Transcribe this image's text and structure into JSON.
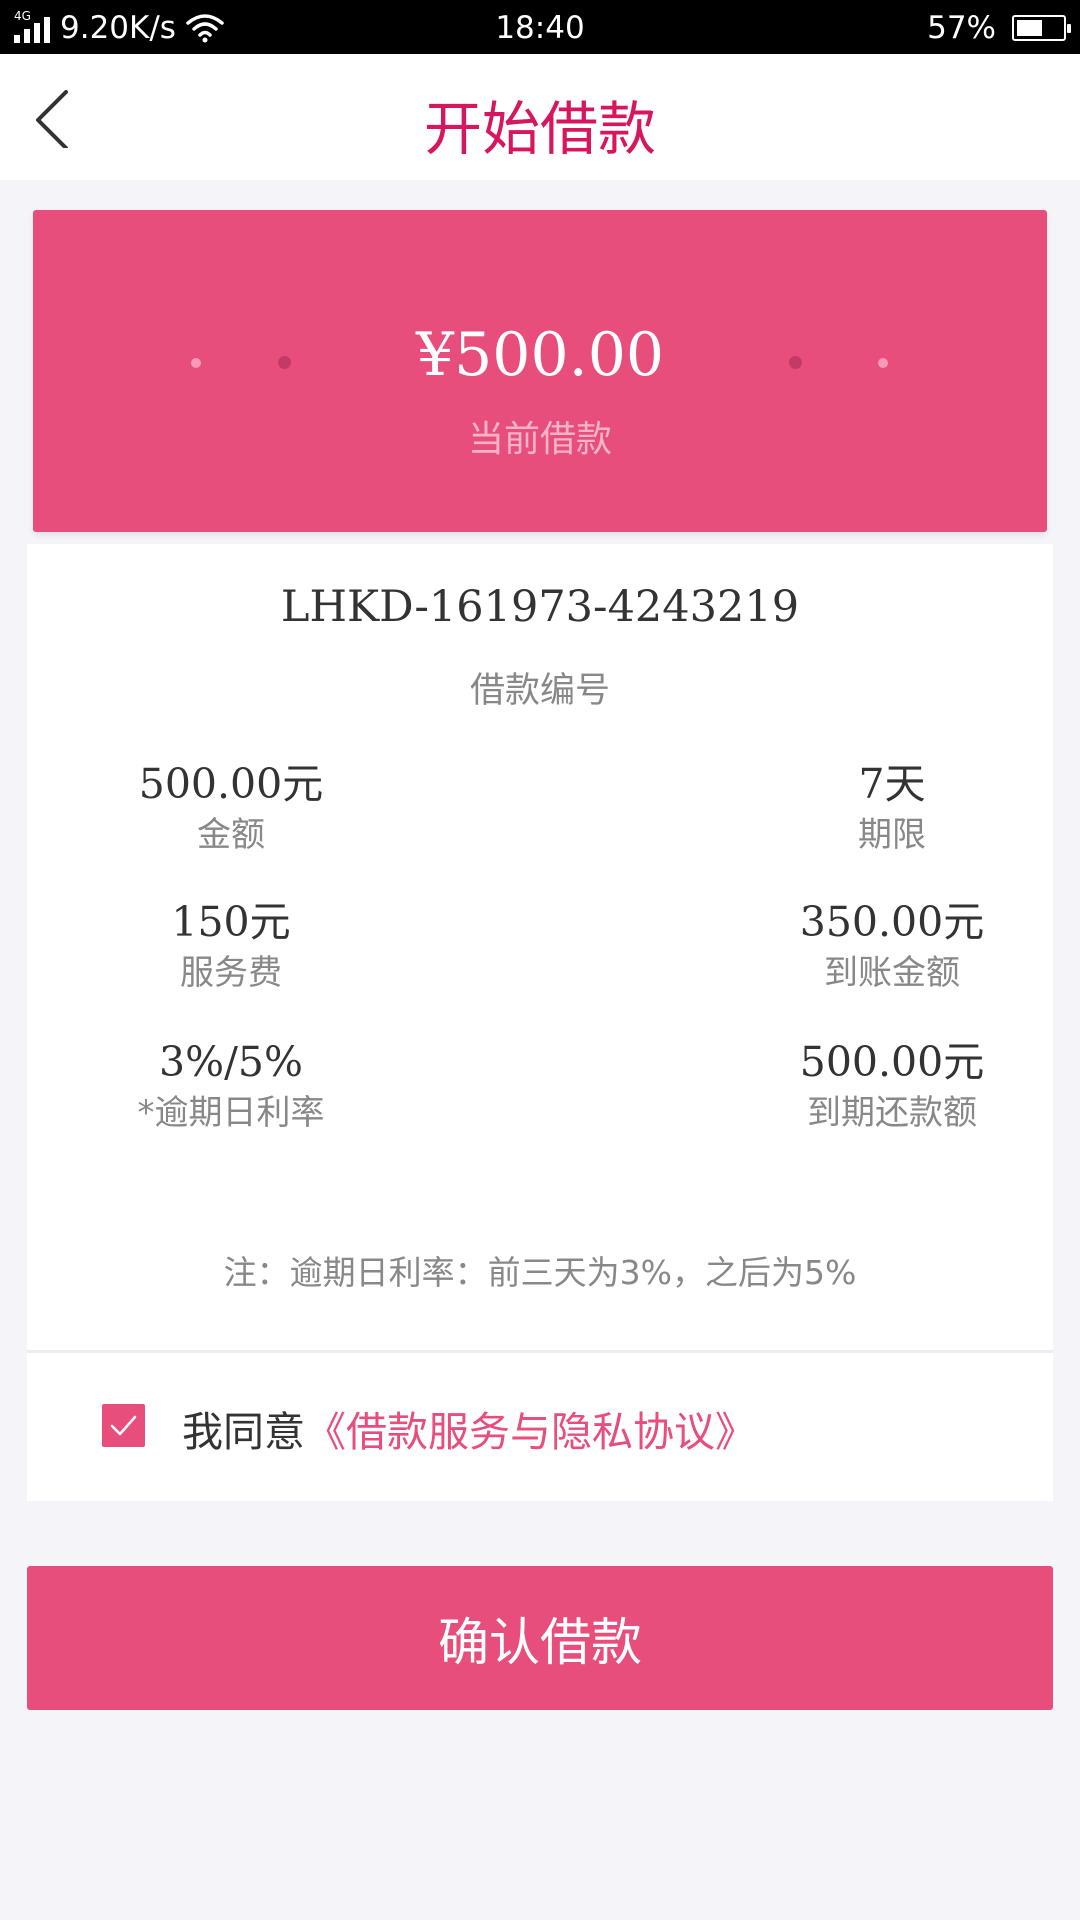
{
  "status_bar": {
    "network": "4G",
    "speed": "9.20K/s",
    "time": "18:40",
    "battery_percent": "57%",
    "battery_level": 0.57
  },
  "nav": {
    "title": "开始借款",
    "back_icon": "chevron-left-icon"
  },
  "hero": {
    "amount": "¥500.00",
    "label": "当前借款"
  },
  "loan": {
    "number": "LHKD-161973-4243219",
    "number_label": "借款编号",
    "stats": [
      {
        "value": "500.00元",
        "label": "金额"
      },
      {
        "value": "7天",
        "label": "期限"
      },
      {
        "value": "150元",
        "label": "服务费"
      },
      {
        "value": "350.00元",
        "label": "到账金额"
      },
      {
        "value": "3%/5%",
        "label": "*逾期日利率"
      },
      {
        "value": "500.00元",
        "label": "到期还款额"
      }
    ],
    "note": "注：逾期日利率：前三天为3%，之后为5%"
  },
  "agreement": {
    "checked": true,
    "prefix": "我同意",
    "link": "《借款服务与隐私协议》"
  },
  "confirm_label": "确认借款",
  "colors": {
    "accent": "#e84e7c",
    "title": "#d6165f",
    "background": "#f4f4f9"
  }
}
